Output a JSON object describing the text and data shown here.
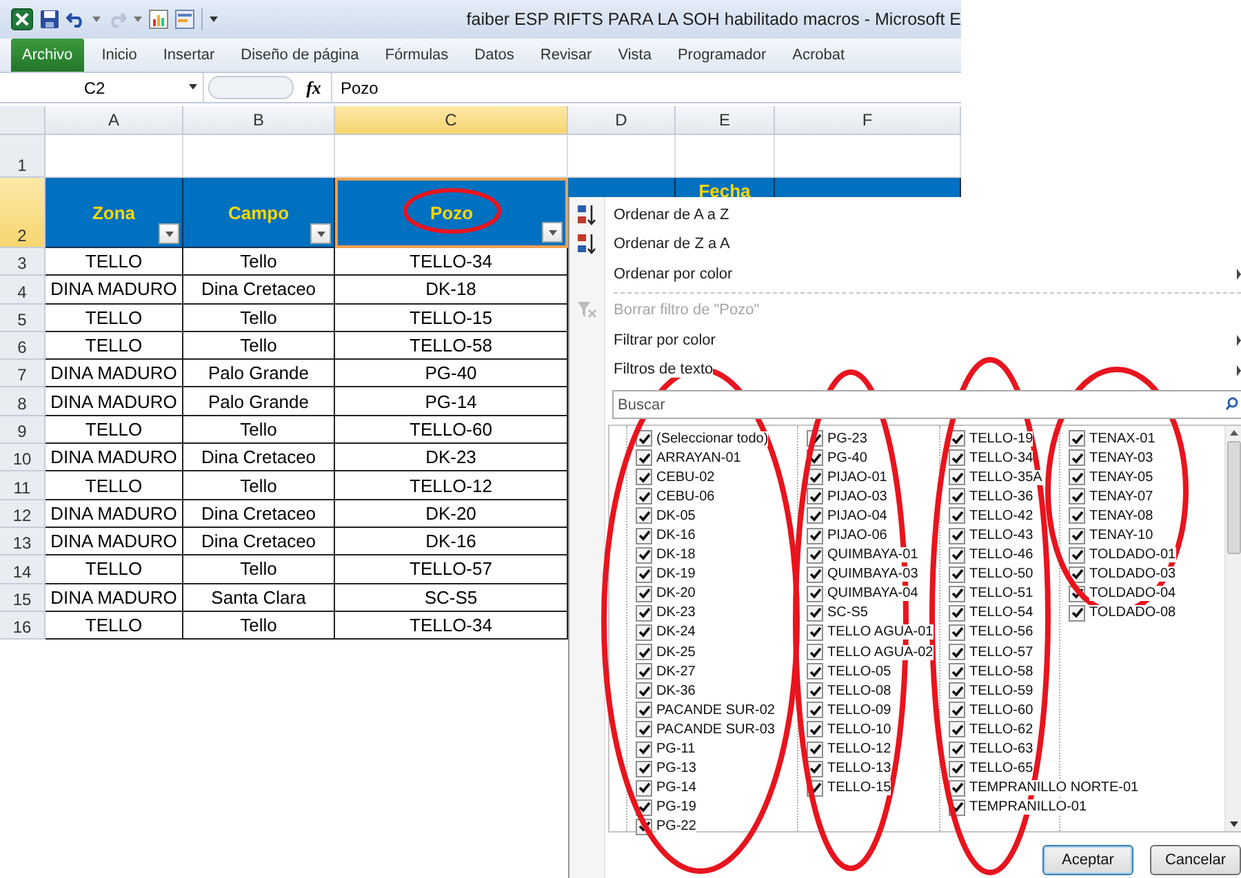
{
  "window": {
    "title": "faiber ESP RIFTS  PARA LA SOH habilitado macros - Microsoft E"
  },
  "ribbon_tabs": [
    {
      "label": "Archivo",
      "kind": "file"
    },
    {
      "label": "Inicio",
      "kind": "tab"
    },
    {
      "label": "Insertar",
      "kind": "tab"
    },
    {
      "label": "Diseño de página",
      "kind": "tab"
    },
    {
      "label": "Fórmulas",
      "kind": "tab"
    },
    {
      "label": "Datos",
      "kind": "tab"
    },
    {
      "label": "Revisar",
      "kind": "tab"
    },
    {
      "label": "Vista",
      "kind": "tab"
    },
    {
      "label": "Programador",
      "kind": "tab"
    },
    {
      "label": "Acrobat",
      "kind": "tab"
    }
  ],
  "formula_bar": {
    "name_box": "C2",
    "function_label": "fx",
    "value": "Pozo"
  },
  "sheet": {
    "columns": [
      {
        "letter": "A",
        "selected": false
      },
      {
        "letter": "B",
        "selected": false
      },
      {
        "letter": "C",
        "selected": true
      },
      {
        "letter": "D",
        "selected": false
      },
      {
        "letter": "E",
        "selected": false
      },
      {
        "letter": "F",
        "selected": false
      }
    ],
    "rows": [
      {
        "number": "1",
        "kind": "blank",
        "selected": false
      },
      {
        "number": "2",
        "kind": "header",
        "selected": true,
        "cells": [
          {
            "text": "Zona",
            "filter": true,
            "active": false
          },
          {
            "text": "Campo",
            "filter": true,
            "active": false
          },
          {
            "text": "Pozo",
            "filter": true,
            "active": true
          },
          {
            "active": false
          },
          {
            "text": "Fecha",
            "active": false
          },
          {
            "active": false
          }
        ]
      },
      {
        "number": "3",
        "kind": "data",
        "selected": false,
        "cells": [
          "TELLO",
          "Tello",
          "TELLO-34"
        ]
      },
      {
        "number": "4",
        "kind": "data",
        "selected": false,
        "cells": [
          "DINA MADURO",
          "Dina Cretaceo",
          "DK-18"
        ]
      },
      {
        "number": "5",
        "kind": "data",
        "selected": false,
        "cells": [
          "TELLO",
          "Tello",
          "TELLO-15"
        ]
      },
      {
        "number": "6",
        "kind": "data",
        "selected": false,
        "cells": [
          "TELLO",
          "Tello",
          "TELLO-58"
        ]
      },
      {
        "number": "7",
        "kind": "data",
        "selected": false,
        "cells": [
          "DINA MADURO",
          "Palo Grande",
          "PG-40"
        ]
      },
      {
        "number": "8",
        "kind": "data",
        "selected": false,
        "cells": [
          "DINA MADURO",
          "Palo Grande",
          "PG-14"
        ]
      },
      {
        "number": "9",
        "kind": "data",
        "selected": false,
        "cells": [
          "TELLO",
          "Tello",
          "TELLO-60"
        ]
      },
      {
        "number": "10",
        "kind": "data",
        "selected": false,
        "cells": [
          "DINA MADURO",
          "Dina Cretaceo",
          "DK-23"
        ]
      },
      {
        "number": "11",
        "kind": "data",
        "selected": false,
        "cells": [
          "TELLO",
          "Tello",
          "TELLO-12"
        ]
      },
      {
        "number": "12",
        "kind": "data",
        "selected": false,
        "cells": [
          "DINA MADURO",
          "Dina Cretaceo",
          "DK-20"
        ]
      },
      {
        "number": "13",
        "kind": "data",
        "selected": false,
        "cells": [
          "DINA MADURO",
          "Dina Cretaceo",
          "DK-16"
        ]
      },
      {
        "number": "14",
        "kind": "data",
        "selected": false,
        "cells": [
          "TELLO",
          "Tello",
          "TELLO-57"
        ]
      },
      {
        "number": "15",
        "kind": "data",
        "selected": false,
        "cells": [
          "DINA MADURO",
          "Santa Clara",
          "SC-S5"
        ]
      },
      {
        "number": "16",
        "kind": "data",
        "selected": false,
        "cells": [
          "TELLO",
          "Tello",
          "TELLO-34"
        ]
      }
    ]
  },
  "filter_menu": {
    "items": [
      {
        "kind": "sort-asc",
        "label": "Ordenar de A a Z",
        "disabled": false,
        "submenu": false
      },
      {
        "kind": "sort-desc",
        "label": "Ordenar de Z a A",
        "disabled": false,
        "submenu": false
      },
      {
        "kind": "plain",
        "label": "Ordenar por color",
        "disabled": false,
        "submenu": true
      },
      {
        "kind": "separator"
      },
      {
        "kind": "clear-filter",
        "label": "Borrar filtro de \"Pozo\"",
        "disabled": true,
        "submenu": false
      },
      {
        "kind": "plain",
        "label": "Filtrar por color",
        "disabled": false,
        "submenu": true
      },
      {
        "kind": "plain",
        "label": "Filtros de texto",
        "disabled": false,
        "submenu": true
      }
    ],
    "search": {
      "placeholder": "Buscar"
    },
    "list_columns": [
      [
        {
          "label": "(Seleccionar todo)",
          "checked": true
        },
        {
          "label": "ARRAYAN-01",
          "checked": true
        },
        {
          "label": "CEBU-02",
          "checked": true
        },
        {
          "label": "CEBU-06",
          "checked": true
        },
        {
          "label": "DK-05",
          "checked": true
        },
        {
          "label": "DK-16",
          "checked": true
        },
        {
          "label": "DK-18",
          "checked": true
        },
        {
          "label": "DK-19",
          "checked": true
        },
        {
          "label": "DK-20",
          "checked": true
        },
        {
          "label": "DK-23",
          "checked": true
        },
        {
          "label": "DK-24",
          "checked": true
        },
        {
          "label": "DK-25",
          "checked": true
        },
        {
          "label": "DK-27",
          "checked": true
        },
        {
          "label": "DK-36",
          "checked": true
        },
        {
          "label": "PACANDE SUR-02",
          "checked": true
        },
        {
          "label": "PACANDE SUR-03",
          "checked": true
        },
        {
          "label": "PG-11",
          "checked": true
        },
        {
          "label": "PG-13",
          "checked": true
        },
        {
          "label": "PG-14",
          "checked": true
        },
        {
          "label": "PG-19",
          "checked": true
        },
        {
          "label": "PG-22",
          "checked": true
        }
      ],
      [
        {
          "label": "PG-23",
          "checked": true
        },
        {
          "label": "PG-40",
          "checked": true
        },
        {
          "label": "PIJAO-01",
          "checked": true
        },
        {
          "label": "PIJAO-03",
          "checked": true
        },
        {
          "label": "PIJAO-04",
          "checked": true
        },
        {
          "label": "PIJAO-06",
          "checked": true
        },
        {
          "label": "QUIMBAYA-01",
          "checked": true
        },
        {
          "label": "QUIMBAYA-03",
          "checked": true
        },
        {
          "label": "QUIMBAYA-04",
          "checked": true
        },
        {
          "label": "SC-S5",
          "checked": true
        },
        {
          "label": "TELLO AGUA-01",
          "checked": true
        },
        {
          "label": "TELLO AGUA-02",
          "checked": true
        },
        {
          "label": "TELLO-05",
          "checked": true
        },
        {
          "label": "TELLO-08",
          "checked": true
        },
        {
          "label": "TELLO-09",
          "checked": true
        },
        {
          "label": "TELLO-10",
          "checked": true
        },
        {
          "label": "TELLO-12",
          "checked": true
        },
        {
          "label": "TELLO-13",
          "checked": true
        },
        {
          "label": "TELLO-15",
          "checked": true
        }
      ],
      [
        {
          "label": "TELLO-19",
          "checked": true
        },
        {
          "label": "TELLO-34",
          "checked": true
        },
        {
          "label": "TELLO-35A",
          "checked": true
        },
        {
          "label": "TELLO-36",
          "checked": true
        },
        {
          "label": "TELLO-42",
          "checked": true
        },
        {
          "label": "TELLO-43",
          "checked": true
        },
        {
          "label": "TELLO-46",
          "checked": true
        },
        {
          "label": "TELLO-50",
          "checked": true
        },
        {
          "label": "TELLO-51",
          "checked": true
        },
        {
          "label": "TELLO-54",
          "checked": true
        },
        {
          "label": "TELLO-56",
          "checked": true
        },
        {
          "label": "TELLO-57",
          "checked": true
        },
        {
          "label": "TELLO-58",
          "checked": true
        },
        {
          "label": "TELLO-59",
          "checked": true
        },
        {
          "label": "TELLO-60",
          "checked": true
        },
        {
          "label": "TELLO-62",
          "checked": true
        },
        {
          "label": "TELLO-63",
          "checked": true
        },
        {
          "label": "TELLO-65",
          "checked": true
        },
        {
          "label": "TEMPRANILLO NORTE-01",
          "checked": true
        },
        {
          "label": "TEMPRANILLO-01",
          "checked": true
        }
      ],
      [
        {
          "label": "TENAX-01",
          "checked": true
        },
        {
          "label": "TENAY-03",
          "checked": true
        },
        {
          "label": "TENAY-05",
          "checked": true
        },
        {
          "label": "TENAY-07",
          "checked": true
        },
        {
          "label": "TENAY-08",
          "checked": true
        },
        {
          "label": "TENAY-10",
          "checked": true
        },
        {
          "label": "TOLDADO-01",
          "checked": true
        },
        {
          "label": "TOLDADO-03",
          "checked": true
        },
        {
          "label": "TOLDADO-04",
          "checked": true
        },
        {
          "label": "TOLDADO-08",
          "checked": true
        }
      ]
    ],
    "buttons": [
      {
        "label": "Aceptar",
        "default": true
      },
      {
        "label": "Cancelar",
        "default": false
      }
    ]
  }
}
